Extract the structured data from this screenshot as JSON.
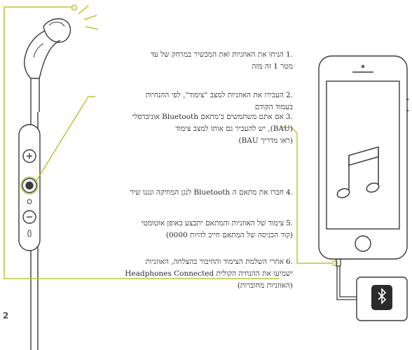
{
  "accent_color": "#b4c93a",
  "page_number": "2",
  "steps": [
    {
      "num": ".1",
      "lines": [
        "הניחו את האוזניות ואת המכשיר במרחק של עד",
        "מטר 1 זה מזה"
      ]
    },
    {
      "num": ".2",
      "lines": [
        "העבירו את האוזניות למצב \"צימוד\", לפי ההנחיות",
        "בעמוד הקודם"
      ]
    },
    {
      "num": ".3",
      "lines": [
        "אם אתם משתמשים ב'מתאם Bluetooth אוניברסלי",
        "(BAU), יש להעביר גם אותו למצב צימוד",
        "(ראו מדריך BAU)"
      ]
    },
    {
      "num": ".4",
      "lines": [
        "חברו את מתאם ה Bluetooth לנגן המוזיקה ונגנו שיר"
      ]
    },
    {
      "num": ".5",
      "lines": [
        "צימוד של האוזניות והמתאם יתבצע באופן אוטומטי",
        "(קוד הכניסה של המתאם חייב להיות 0000)"
      ]
    },
    {
      "num": ".6",
      "lines": [
        "אחרי השלמת הצימוד והחיבור בהצלחה, האוזניות",
        "ישמיעו את ההנחיה הקולית Headphones Connected",
        "(האוזניות מחוברות)"
      ]
    }
  ],
  "icons": {
    "earbud": "earbud-icon",
    "remote": "remote-control-icon",
    "phone": "smartphone-icon",
    "music": "music-note-icon",
    "adapter": "bluetooth-adapter-icon",
    "bluetooth": "bluetooth-icon"
  }
}
